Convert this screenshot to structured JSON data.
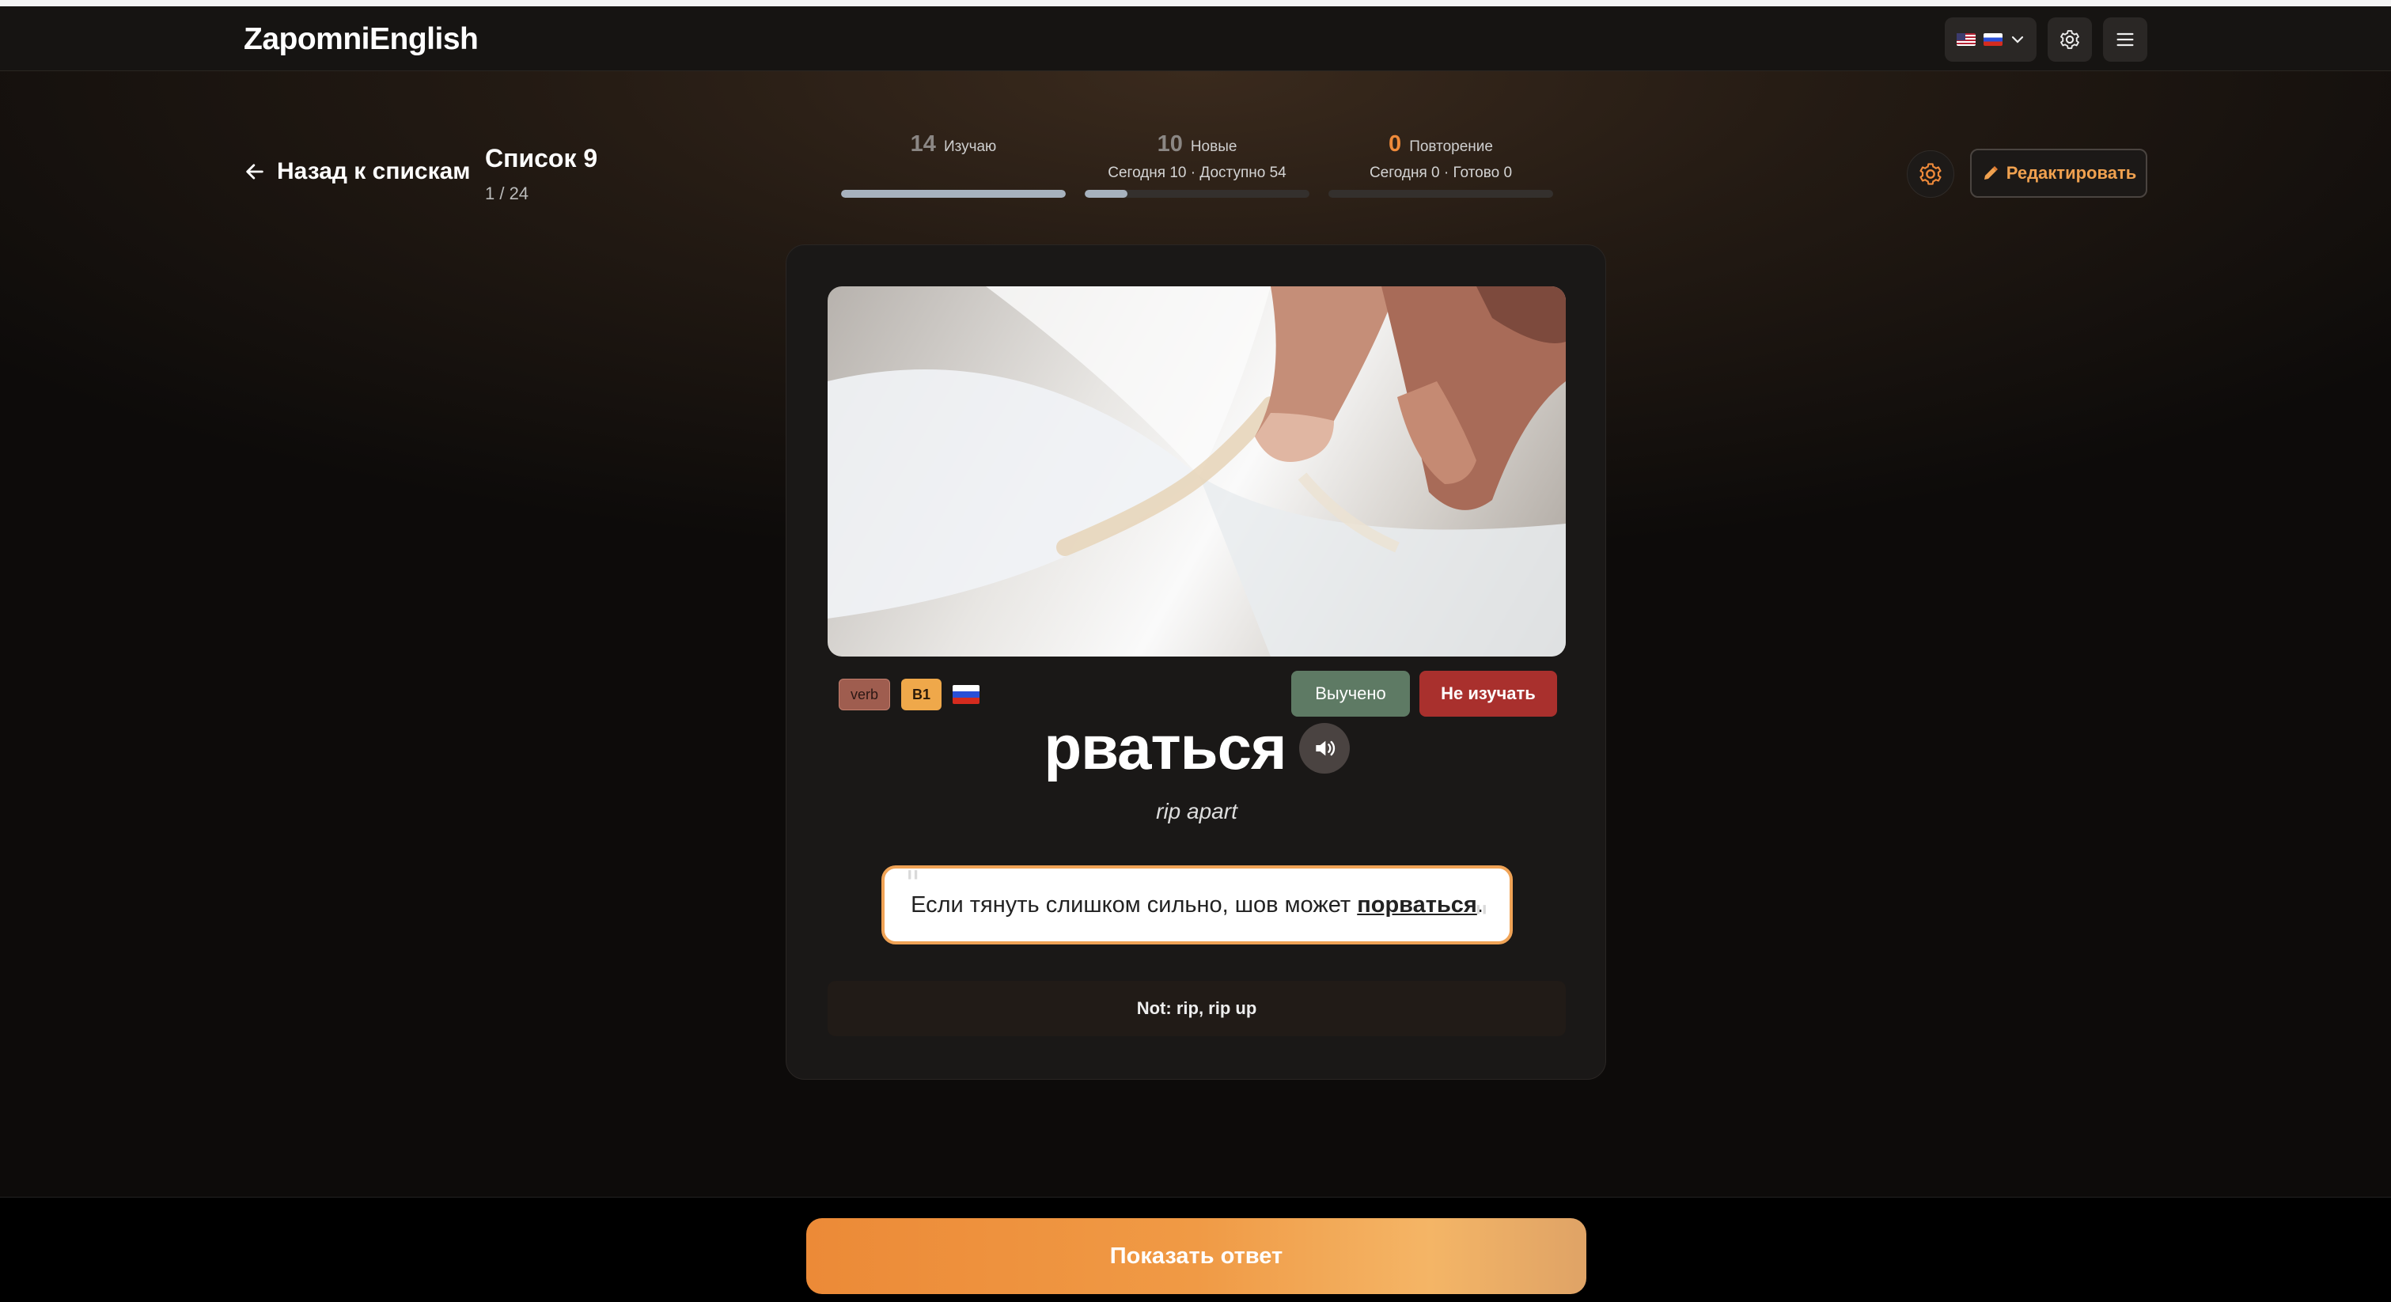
{
  "app": {
    "name": "ZapomniEnglish"
  },
  "navbar": {
    "language_icons": [
      "flag-us",
      "flag-ru"
    ],
    "settings_icon": "gear-icon",
    "menu_icon": "hamburger-icon"
  },
  "header": {
    "back_label": "Назад к спискам",
    "list_title": "Список 9",
    "list_progress": "1 / 24",
    "edit_label": "Редактировать"
  },
  "stats": [
    {
      "number": "14",
      "label": "Изучаю",
      "sub": "",
      "fill": 1.0
    },
    {
      "number": "10",
      "label": "Новые",
      "sub": "Сегодня 10 · Доступно 54",
      "fill": 0.19
    },
    {
      "number": "0",
      "label": "Повторение",
      "sub": "Сегодня 0 · Готово 0",
      "fill": 0.0
    }
  ],
  "card": {
    "tags": {
      "pos": "verb",
      "level": "B1",
      "lang_flag": "flag-ru"
    },
    "learned_label": "Выучено",
    "skip_label": "Не изучать",
    "word": "рваться",
    "translation": "rip apart",
    "example": {
      "before": "Если тянуть слишком сильно, шов может ",
      "highlight": "порваться",
      "after": "."
    },
    "note": "Not: rip, rip up"
  },
  "footer": {
    "show_answer_label": "Показать ответ"
  },
  "colors": {
    "accent": "#ef8a3a",
    "learned": "#5e7a64",
    "skip": "#a9302d"
  }
}
